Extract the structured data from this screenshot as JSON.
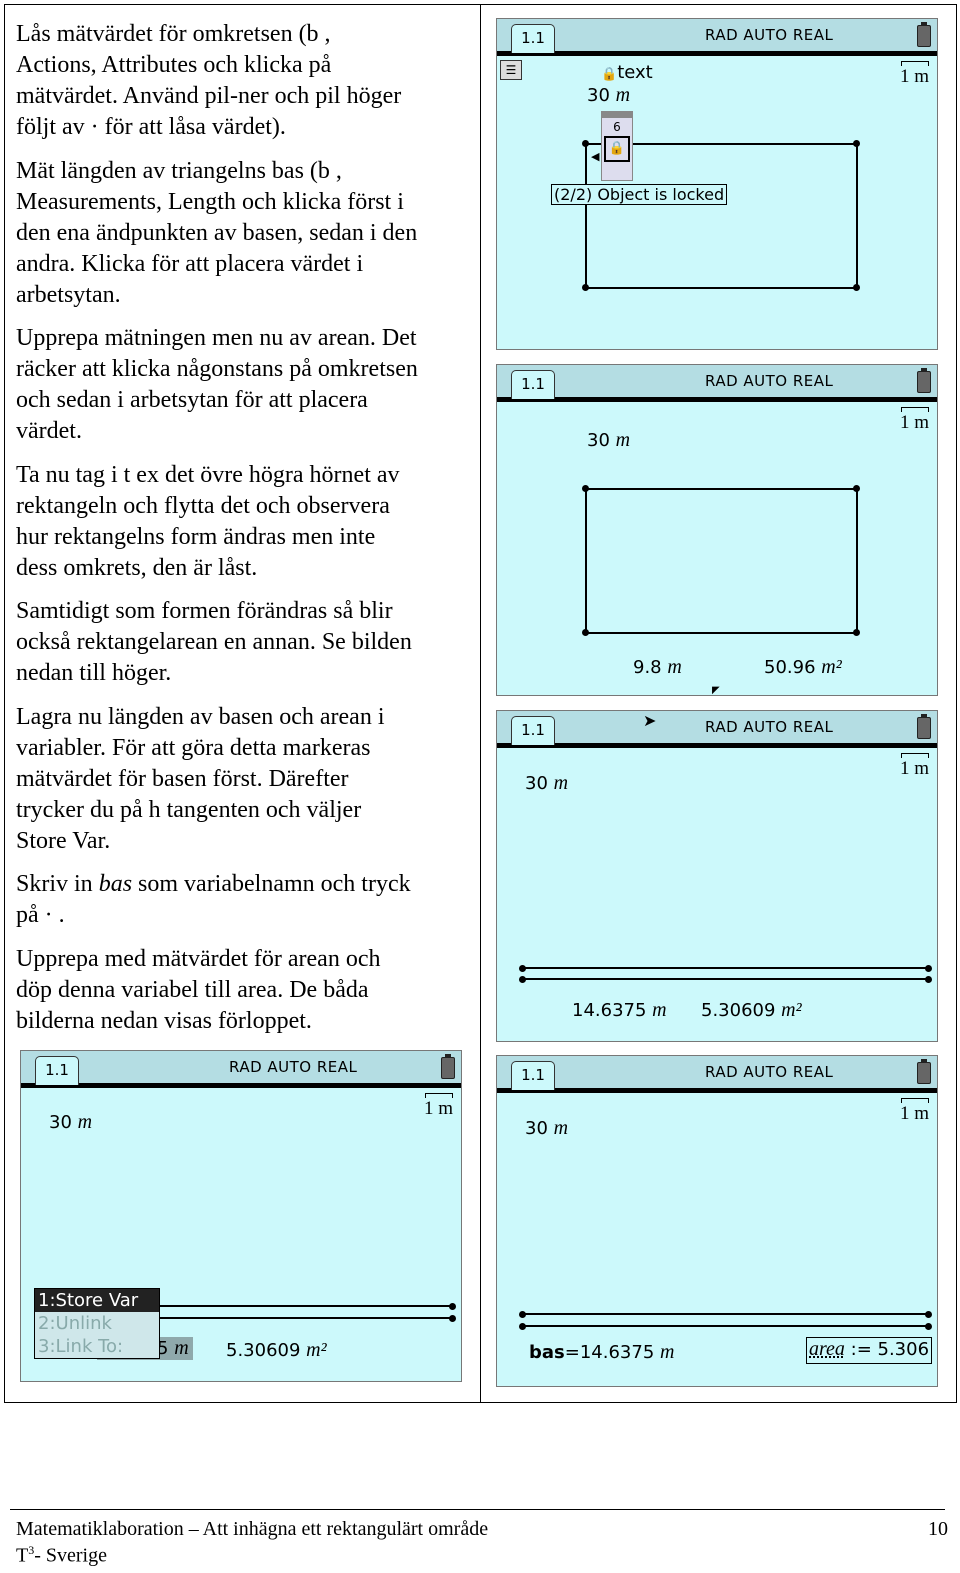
{
  "text": {
    "p1": [
      "Lås mätvärdet för omkretsen (b    ,",
      "Actions, Attributes och klicka på",
      "mätvärdet. Använd pil-ner och pil höger",
      "följt av ·    för att låsa värdet)."
    ],
    "p2": [
      "Mät längden av triangelns bas (b    ,",
      "Measurements, Length och klicka först i",
      "den ena ändpunkten av basen, sedan i den",
      "andra. Klicka för att placera värdet i",
      "arbetsytan."
    ],
    "p3": [
      "Upprepa mätningen men nu av arean. Det",
      "räcker att klicka någonstans på omkretsen",
      "och sedan i arbetsytan för att placera",
      "värdet."
    ],
    "p4": [
      "Ta nu tag i t ex det övre högra hörnet av",
      "rektangeln och flytta det och observera",
      "hur rektangelns form ändras men inte",
      "dess omkrets, den är låst."
    ],
    "p5": [
      "Samtidigt som formen förändras så blir",
      "också rektangelarean en annan. Se bilden",
      "nedan till höger."
    ],
    "p6": [
      "Lagra  nu längden av basen och arean i",
      "variabler. För att göra detta markeras",
      "mätvärdet för basen först. Därefter",
      "trycker du på h    tangenten och väljer",
      "Store Var."
    ],
    "p7": {
      "before": "Skriv in ",
      "italic": "bas",
      "after": " som variabelnamn och tryck",
      "line2": "på ·    ."
    },
    "p8": [
      "Upprepa med mätvärdet för arean och",
      "döp denna variabel till area. De båda",
      "bilderna nedan visas förloppet."
    ]
  },
  "screen": {
    "tab": "1.1",
    "mode": "RAD  AUTO  REAL",
    "scale": "1 m",
    "bg_color": "#ccf9fb",
    "header_color": "#b4dde3"
  },
  "screen_a": {
    "text_label": "text",
    "perimeter": "30",
    "unit": "m",
    "lock_number": "6",
    "tooltip": "(2/2) Object is locked"
  },
  "screen_b": {
    "perimeter": "30",
    "unit": "m",
    "base": "9.8",
    "area": "50.96",
    "area_unit": "m²"
  },
  "screen_c": {
    "perimeter": "30",
    "unit": "m",
    "base": "14.6375",
    "area": "5.30609",
    "area_unit": "m²"
  },
  "screen_d": {
    "perimeter": "30",
    "unit": "m",
    "base_partial": "5",
    "area": "5.30609",
    "area_unit": "m²",
    "menu": [
      "1:Store Var",
      "2:Unlink",
      "3:Link To:"
    ]
  },
  "screen_e": {
    "perimeter": "30",
    "unit": "m",
    "bas_name": "bas",
    "bas_value": "=14.6375",
    "area_name": "area",
    "area_value": " := 5.306"
  },
  "footer": {
    "title": "Matematiklaboration – Att inhägna ett rektangulärt område",
    "page": "10",
    "org_t": "T",
    "org_sup": "3",
    "org_rest": "- Sverige"
  }
}
